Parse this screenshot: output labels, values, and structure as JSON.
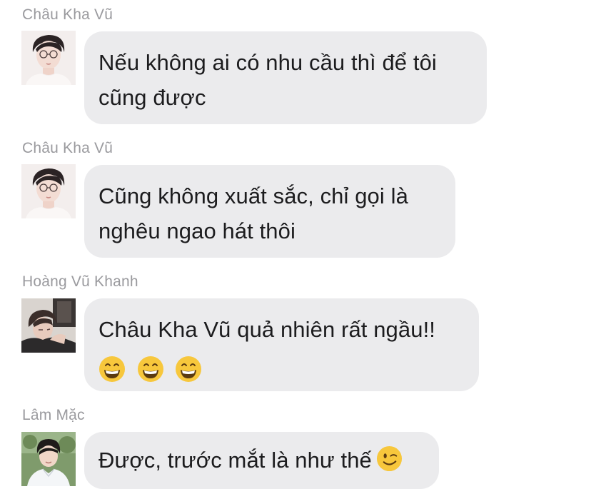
{
  "messages": [
    {
      "sender": "Châu Kha Vũ",
      "lines": [
        "Nếu không ai có nhu cầu thì để tôi",
        "cũng được"
      ],
      "avatar_icon": "avatar-chau-kha-vu"
    },
    {
      "sender": "Châu Kha Vũ",
      "lines": [
        "Cũng không xuất sắc, chỉ gọi là",
        "nghêu ngao hát thôi"
      ],
      "avatar_icon": "avatar-chau-kha-vu"
    },
    {
      "sender": "Hoàng Vũ Khanh",
      "lines": [
        "Châu Kha Vũ quả nhiên rất ngầu!!"
      ],
      "emojis": [
        "grinning-face",
        "grinning-face",
        "grinning-face"
      ],
      "avatar_icon": "avatar-hoang-vu-khanh"
    },
    {
      "sender": "Lâm Mặc",
      "lines": [
        "Được, trước mắt là như thế"
      ],
      "trailing_emoji": "winking-face",
      "avatar_icon": "avatar-lam-mac"
    }
  ],
  "colors": {
    "bubble": "#ebebed",
    "sender_text": "#9a9a9e",
    "message_text": "#1c1c1e",
    "emoji_face": "#f7c73c"
  }
}
